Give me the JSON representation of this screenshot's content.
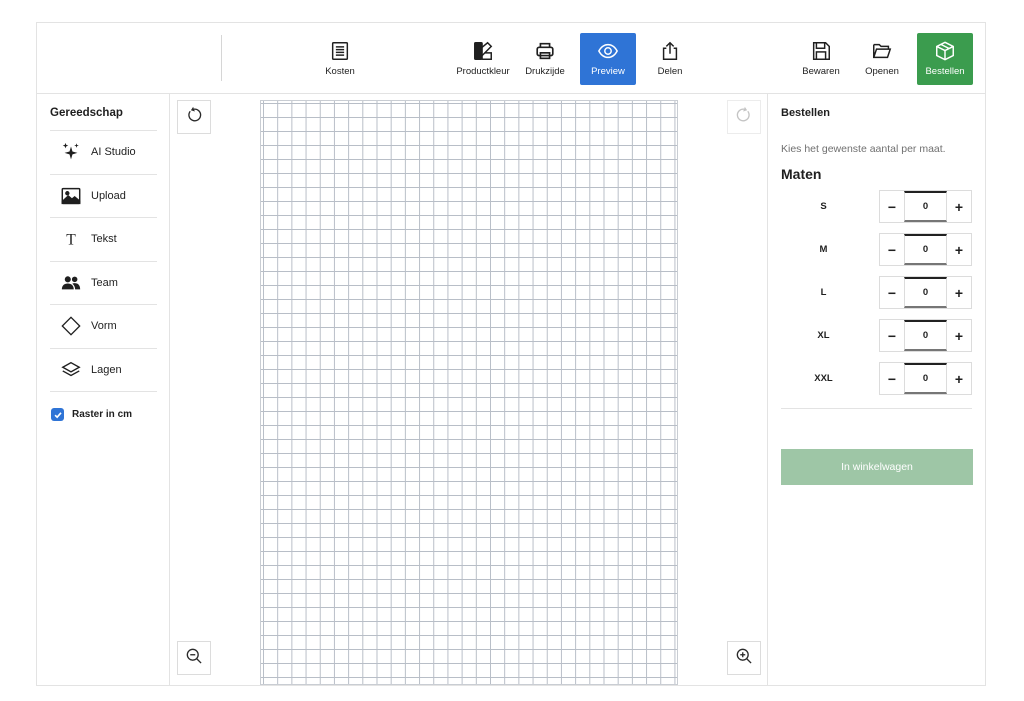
{
  "toolbar": {
    "costs_label": "Kosten",
    "product_color_label": "Productkleur",
    "print_side_label": "Drukzijde",
    "preview_label": "Preview",
    "share_label": "Delen",
    "save_label": "Bewaren",
    "open_label": "Openen",
    "order_label": "Bestellen"
  },
  "tools_panel": {
    "title": "Gereedschap",
    "items": [
      {
        "label": "AI Studio",
        "icon": "sparkles-icon"
      },
      {
        "label": "Upload",
        "icon": "image-icon"
      },
      {
        "label": "Tekst",
        "icon": "text-icon"
      },
      {
        "label": "Team",
        "icon": "team-icon"
      },
      {
        "label": "Vorm",
        "icon": "diamond-shape-icon"
      },
      {
        "label": "Lagen",
        "icon": "layers-icon"
      }
    ],
    "grid_option": {
      "label": "Raster in cm",
      "checked": true
    }
  },
  "canvas": {
    "undo_icon": "undo-icon",
    "redo_icon": "redo-icon",
    "zoom_out_icon": "zoom-out-icon",
    "zoom_in_icon": "zoom-in-icon"
  },
  "order_panel": {
    "title": "Bestellen",
    "instruction": "Kies het gewenste aantal per maat.",
    "sizes_heading": "Maten",
    "sizes": [
      {
        "size": "S",
        "qty": "0"
      },
      {
        "size": "M",
        "qty": "0"
      },
      {
        "size": "L",
        "qty": "0"
      },
      {
        "size": "XL",
        "qty": "0"
      },
      {
        "size": "XXL",
        "qty": "0"
      }
    ],
    "minus_symbol": "−",
    "plus_symbol": "+",
    "cart_button_label": "In winkelwagen"
  },
  "colors": {
    "preview_active": "#2f74d6",
    "order_button": "#3b9c4e",
    "cart_button_disabled": "#9ec6a6",
    "checkbox": "#2f74d6"
  }
}
